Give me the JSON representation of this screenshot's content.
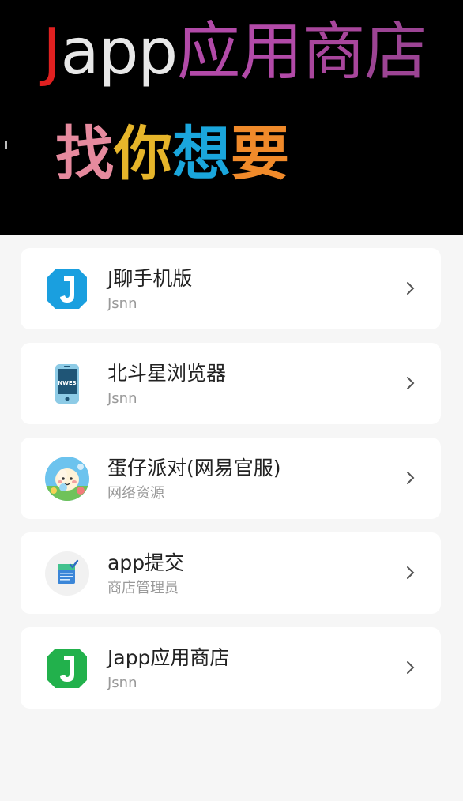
{
  "banner": {
    "title_glyphs": [
      {
        "t": "J",
        "color": "#e02020"
      },
      {
        "t": "a",
        "color": "#e8e8e8"
      },
      {
        "t": "p",
        "color": "#e8e8e8"
      },
      {
        "t": "p",
        "color": "#e8e8e8"
      },
      {
        "t": "应",
        "color": "#b24aa8"
      },
      {
        "t": "用",
        "color": "#b24aa8"
      },
      {
        "t": "商",
        "color": "#a8469c"
      },
      {
        "t": "店",
        "color": "#9c4494"
      }
    ],
    "subtitle_glyphs": [
      {
        "t": "找",
        "color": "#e68a9e"
      },
      {
        "t": "你",
        "color": "#e6b52a"
      },
      {
        "t": "想",
        "color": "#1aa6dc"
      },
      {
        "t": "要",
        "color": "#f08a2a"
      }
    ]
  },
  "apps": [
    {
      "name": "J聊手机版",
      "author": "Jsnn",
      "icon": "j-chat-blue-icon",
      "icon_color": "#1a9fdf"
    },
    {
      "name": "北斗星浏览器",
      "author": "Jsnn",
      "icon": "phone-browser-icon",
      "icon_color": "#7fc6e6",
      "icon_text": "NWES"
    },
    {
      "name": "蛋仔派对(网易官服)",
      "author": "网络资源",
      "icon": "egg-party-mascot-icon",
      "icon_color": "#58b6e8"
    },
    {
      "name": "app提交",
      "author": "商店管理员",
      "icon": "document-check-icon",
      "icon_color": "#2c7ad6"
    },
    {
      "name": "Japp应用商店",
      "author": "Jsnn",
      "icon": "j-store-green-icon",
      "icon_color": "#22b14c"
    }
  ]
}
